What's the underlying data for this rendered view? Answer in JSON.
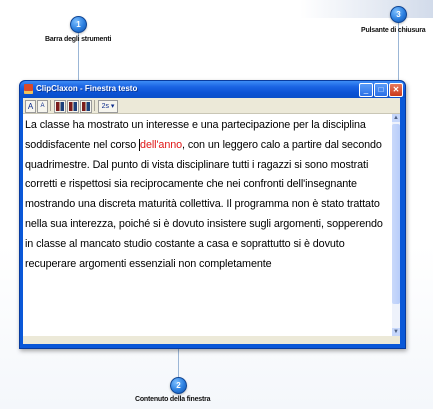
{
  "callouts": [
    {
      "number": "1",
      "label": "Barra degli strumenti"
    },
    {
      "number": "3",
      "label": "Pulsante di chiusura"
    },
    {
      "number": "2",
      "label": "Contenuto della finestra"
    }
  ],
  "window": {
    "title": "ClipClaxon - Finestra testo",
    "minimize_glyph": "_",
    "maximize_glyph": "□",
    "close_glyph": "✕"
  },
  "toolbar": {
    "font_larger_label": "A",
    "font_smaller_label": "A",
    "speed_label": "2s ▾"
  },
  "content": {
    "before_highlight": "La classe ha mostrato un interesse e una partecipazione per la disciplina soddisfacente nel corso ",
    "highlight": "dell'anno",
    "after_highlight": ", con un leggero calo a partire dal secondo quadrimestre. Dal punto di vista disciplinare tutti i ragazzi si sono mostrati corretti e rispettosi sia reciprocamente che nei confronti dell'insegnante mostrando una discreta maturità collettiva. Il programma non è stato trattato nella sua interezza, poiché si è dovuto insistere  sugli argomenti, sopperendo in classe al mancato studio costante a casa e soprattutto si è dovuto recuperare argomenti essenziali non completamente"
  },
  "colors": {
    "titlebar": "#0a58d8",
    "highlight_text": "#e01818",
    "callout": "#2b7fe0"
  }
}
